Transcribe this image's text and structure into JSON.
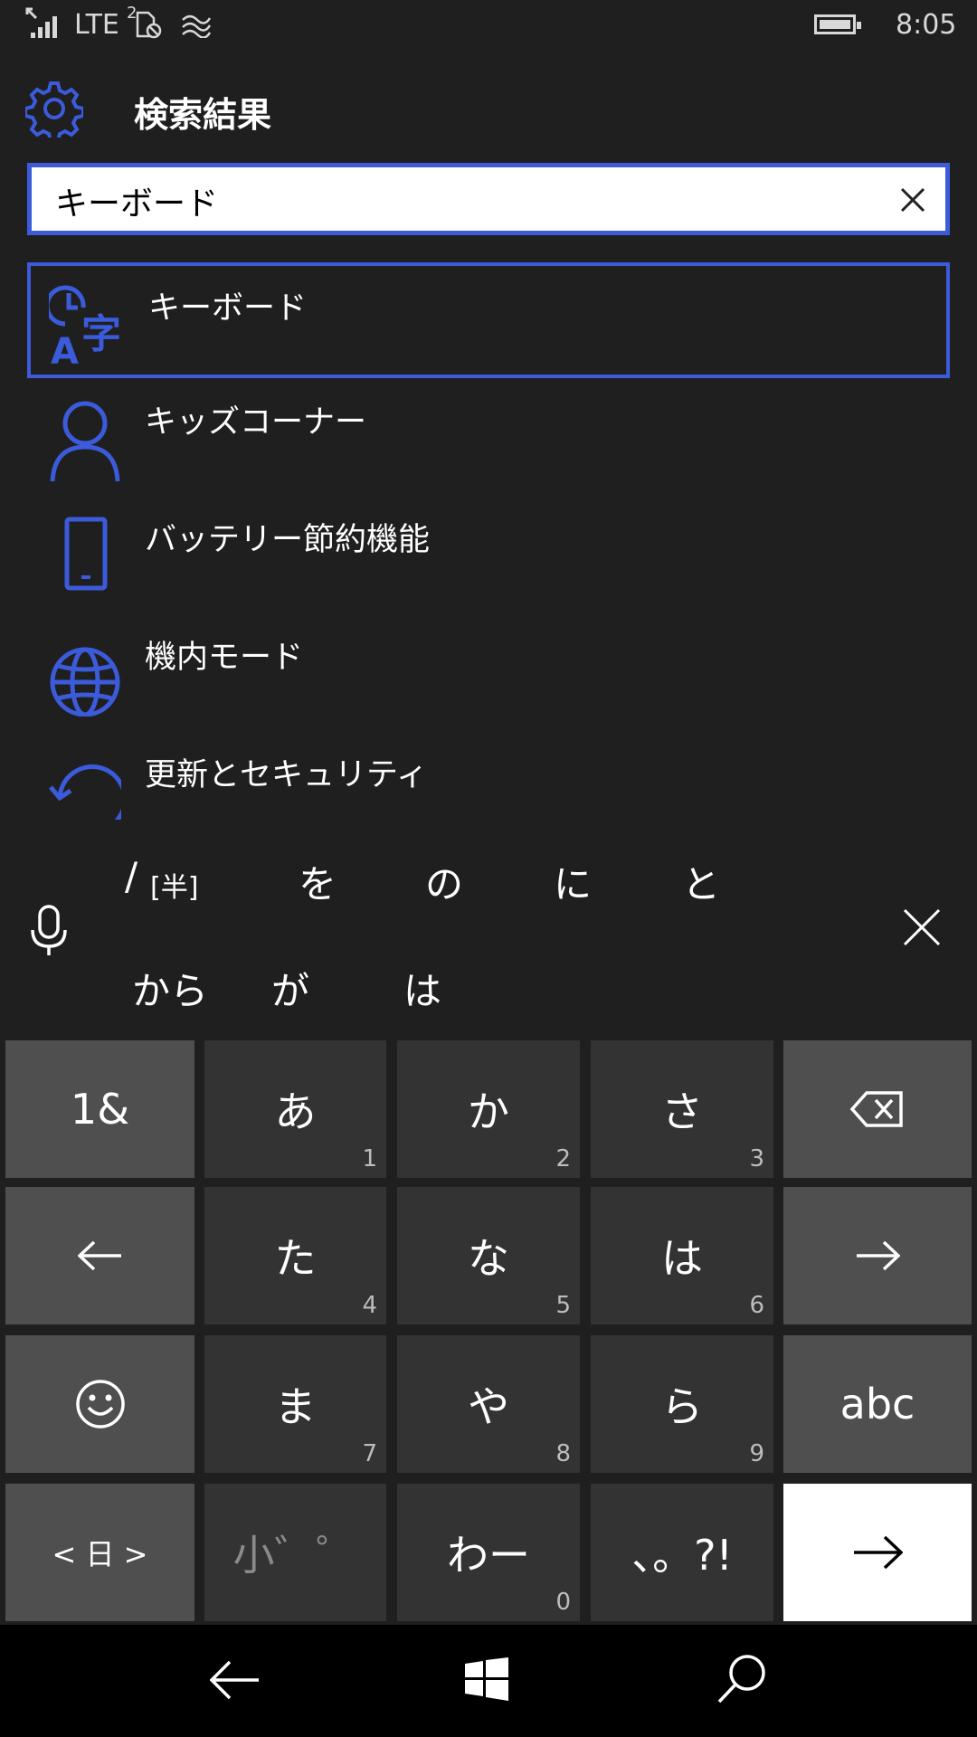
{
  "status_bar": {
    "network": "LTE",
    "sim": "2",
    "time": "8:05"
  },
  "header": {
    "title": "検索結果",
    "settings_icon": "gear-icon"
  },
  "search": {
    "value": "キーボード",
    "clear_icon": "close-icon"
  },
  "results": [
    {
      "label": "キーボード",
      "icon": "time-language-icon",
      "selected": true
    },
    {
      "label": "キッズコーナー",
      "icon": "person-icon",
      "selected": false
    },
    {
      "label": "バッテリー節約機能",
      "icon": "phone-icon",
      "selected": false
    },
    {
      "label": "機内モード",
      "icon": "globe-icon",
      "selected": false
    },
    {
      "label": "更新とセキュリティ",
      "icon": "refresh-icon",
      "selected": false
    }
  ],
  "suggestions": {
    "row1": [
      "/",
      "[半]",
      "を",
      "の",
      "に",
      "と"
    ],
    "row2": [
      "から",
      "が",
      "は"
    ],
    "mic_icon": "microphone-icon",
    "close_icon": "close-icon"
  },
  "keyboard": {
    "rows": [
      [
        {
          "label": "1&",
          "num": "",
          "type": "fn"
        },
        {
          "label": "あ",
          "num": "1",
          "type": "char"
        },
        {
          "label": "か",
          "num": "2",
          "type": "char"
        },
        {
          "label": "さ",
          "num": "3",
          "type": "char"
        },
        {
          "label": "",
          "num": "",
          "type": "fn",
          "icon": "backspace-icon"
        }
      ],
      [
        {
          "label": "",
          "num": "",
          "type": "fn",
          "icon": "arrow-left-icon"
        },
        {
          "label": "た",
          "num": "4",
          "type": "char"
        },
        {
          "label": "な",
          "num": "5",
          "type": "char"
        },
        {
          "label": "は",
          "num": "6",
          "type": "char"
        },
        {
          "label": "",
          "num": "",
          "type": "fn",
          "icon": "arrow-right-icon"
        }
      ],
      [
        {
          "label": "",
          "num": "",
          "type": "fn",
          "icon": "emoji-icon"
        },
        {
          "label": "ま",
          "num": "7",
          "type": "char"
        },
        {
          "label": "や",
          "num": "8",
          "type": "char"
        },
        {
          "label": "ら",
          "num": "9",
          "type": "char"
        },
        {
          "label": "abc",
          "num": "",
          "type": "fn"
        }
      ],
      [
        {
          "label": "< 日 >",
          "num": "",
          "type": "fn"
        },
        {
          "label": "小゛゜",
          "num": "",
          "type": "dim"
        },
        {
          "label": "わー",
          "num": "0",
          "type": "char"
        },
        {
          "label": "、。?!",
          "num": "",
          "type": "char"
        },
        {
          "label": "",
          "num": "",
          "type": "enter",
          "icon": "enter-arrow-icon"
        }
      ]
    ]
  },
  "navbar": {
    "back_icon": "back-icon",
    "start_icon": "windows-icon",
    "search_icon": "search-icon"
  },
  "colors": {
    "accent": "#3b5bdb",
    "background": "#1f1f1f",
    "key": "#333333",
    "key_function": "#4f4f4f"
  }
}
